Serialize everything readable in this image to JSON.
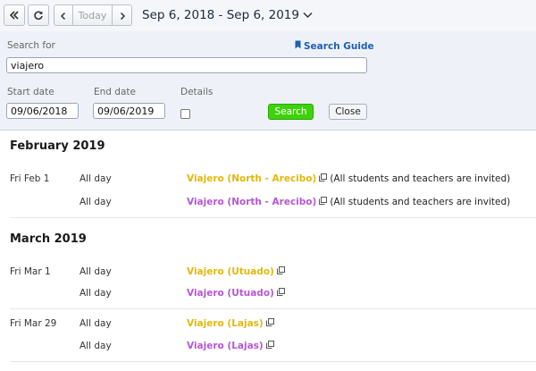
{
  "toolbar": {
    "today_label": "Today",
    "date_range": "Sep 6, 2018 - Sep 6, 2019"
  },
  "search": {
    "search_for_label": "Search for",
    "query": "viajero",
    "guide_label": "Search Guide",
    "start_label": "Start date",
    "start_value": "09/06/2018",
    "end_label": "End date",
    "end_value": "09/06/2019",
    "details_label": "Details",
    "details_checked": false,
    "search_button": "Search",
    "close_button": "Close"
  },
  "colors": {
    "accent_green": "#3ed20c",
    "event_gold": "#e2b80c",
    "event_purple": "#b657d4",
    "link_blue": "#1f5fb5"
  },
  "months": [
    {
      "title": "February 2019",
      "rows": [
        {
          "date": "Fri Feb 1",
          "time": "All day",
          "title": "Viajero (North - Arecibo)",
          "color": "gold",
          "note": "(All students and teachers are invited)"
        },
        {
          "date": "",
          "time": "All day",
          "title": "Viajero (North - Arecibo)",
          "color": "purple",
          "note": "(All students and teachers are invited)"
        }
      ]
    },
    {
      "title": "March 2019",
      "rows": [
        {
          "date": "Fri Mar 1",
          "time": "All day",
          "title": "Viajero (Utuado)",
          "color": "gold",
          "note": ""
        },
        {
          "date": "",
          "time": "All day",
          "title": "Viajero (Utuado)",
          "color": "purple",
          "note": ""
        },
        {
          "date": "Fri Mar 29",
          "time": "All day",
          "title": "Viajero (Lajas)",
          "color": "gold",
          "note": ""
        },
        {
          "date": "",
          "time": "All day",
          "title": "Viajero (Lajas)",
          "color": "purple",
          "note": ""
        }
      ]
    }
  ]
}
